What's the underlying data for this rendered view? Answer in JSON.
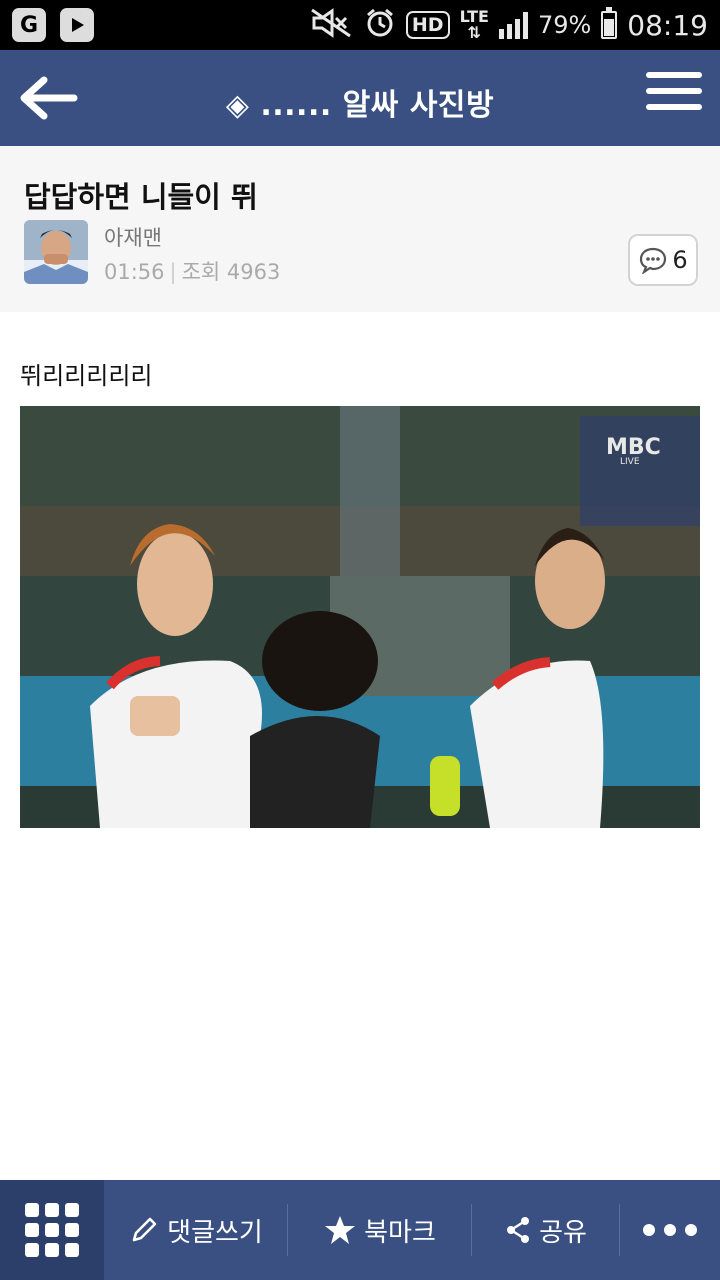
{
  "status_bar": {
    "battery_percent": "79%",
    "battery_level": 0.79,
    "network": "LTE",
    "hd_label": "HD",
    "time": "08:19",
    "icons": [
      "g-app-icon",
      "play-app-icon",
      "mute-icon",
      "alarm-icon",
      "hd-voice-icon",
      "lte-icon",
      "signal-icon",
      "battery-icon"
    ]
  },
  "header": {
    "title": "◈ ...... 알싸 사진방",
    "back_icon": "arrow-left-icon",
    "menu_icon": "hamburger-menu-icon",
    "accent": "#3a5082"
  },
  "post": {
    "title": "답답하면 니들이 뛰",
    "author": "아재맨",
    "time": "01:56",
    "views_label": "조회 4963",
    "comment_count": "6",
    "body": "뛰리리리리리",
    "image_caption": "MBC",
    "image_caption_sub": "LIVE"
  },
  "bottom_bar": {
    "grid_icon": "apps-grid-icon",
    "write_comment": "댓글쓰기",
    "bookmark": "북마크",
    "share": "공유",
    "more_icon": "more-dots-icon"
  }
}
